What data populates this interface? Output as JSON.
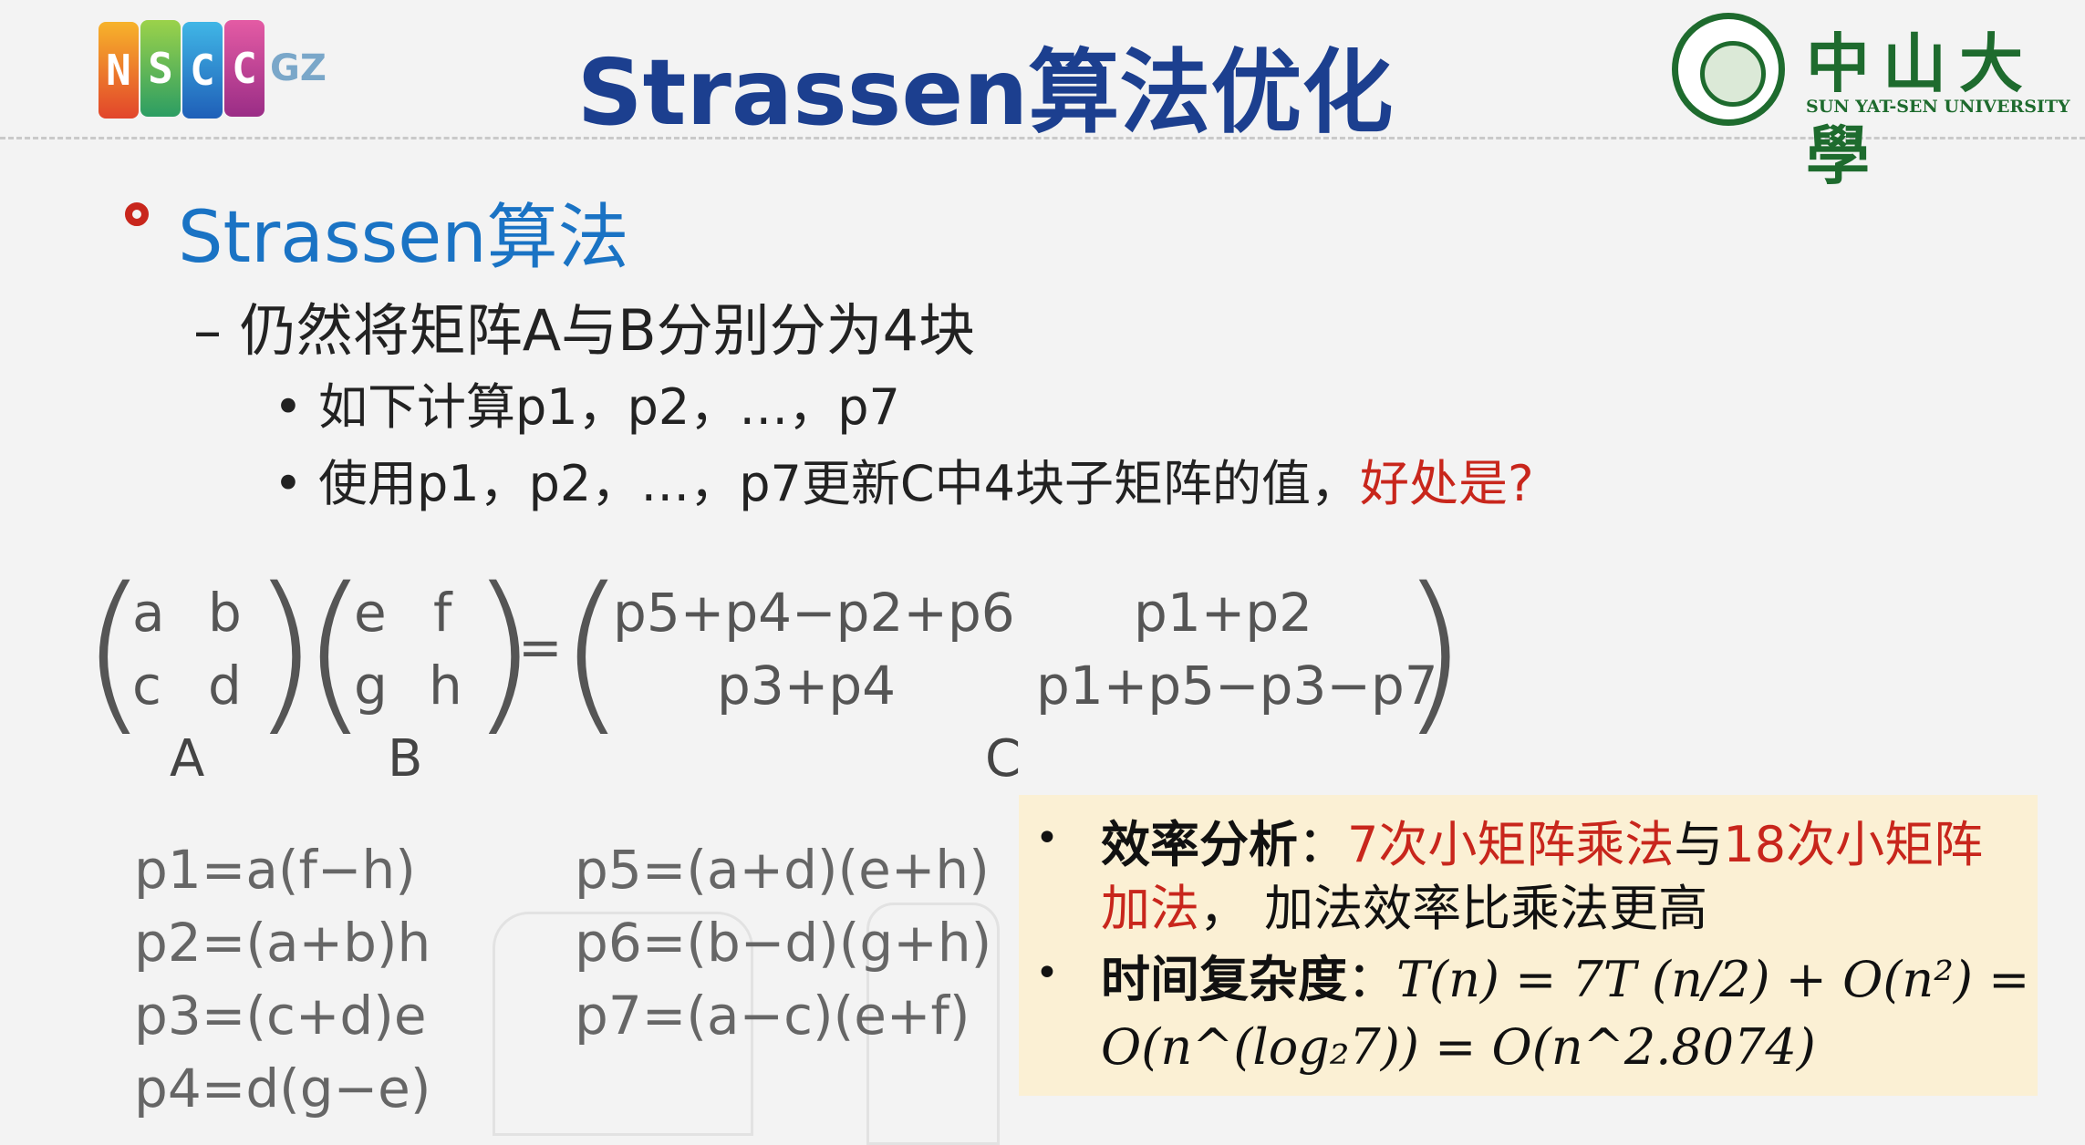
{
  "header": {
    "title": "Strassen算法优化",
    "left_logo_letters": [
      "N",
      "S",
      "C",
      "C"
    ],
    "left_logo_suffix": "GZ",
    "right_logo_cn": "中山大學",
    "right_logo_en": "SUN YAT-SEN UNIVERSITY"
  },
  "content": {
    "heading": "Strassen算法",
    "sub": "– 仍然将矩阵A与B分别分为4块",
    "bullet1": "• 如下计算p1，p2，…，p7",
    "bullet2_main": "• 使用p1，p2，…，p7更新C中4块子矩阵的值，",
    "bullet2_red": "好处是?"
  },
  "matrix": {
    "A": [
      "a",
      "b",
      "c",
      "d"
    ],
    "B": [
      "e",
      "f",
      "g",
      "h"
    ],
    "equals": "=",
    "C": [
      "p5+p4−p2+p6",
      "p1+p2",
      "p3+p4",
      "p1+p5−p3−p7"
    ],
    "labels": [
      "A",
      "B",
      "C"
    ]
  },
  "formulas": {
    "left": [
      "p1=a(f−h)",
      "p2=(a+b)h",
      "p3=(c+d)e",
      "p4=d(g−e)"
    ],
    "right": [
      "p5=(a+d)(e+h)",
      "p6=(b−d)(g+h)",
      "p7=(a−c)(e+f)"
    ]
  },
  "note": {
    "bullet": "•",
    "efficiency_label": "效率分析",
    "colon": "：",
    "seven": "7次小矩阵乘法",
    "yu": "与",
    "eighteen": "18次小矩阵",
    "add": "加法",
    "comma": "，",
    "add_tail": "加法效率比乘法更高",
    "time_label": "时间复杂度",
    "eq1": "T(n) = 7T (n/2) + O(n²) =",
    "eq2": "O(n^(log₂7)) = O(n^2.8074)"
  },
  "colors": {
    "title": "#1c3f8f",
    "heading": "#1a73c4",
    "accent_red": "#c8261c",
    "sysu_green": "#1e6b2e",
    "note_bg": "#fbf0d4"
  },
  "icons": [
    "nscc-logo",
    "sysu-seal-icon",
    "ring-bullet-icon"
  ]
}
